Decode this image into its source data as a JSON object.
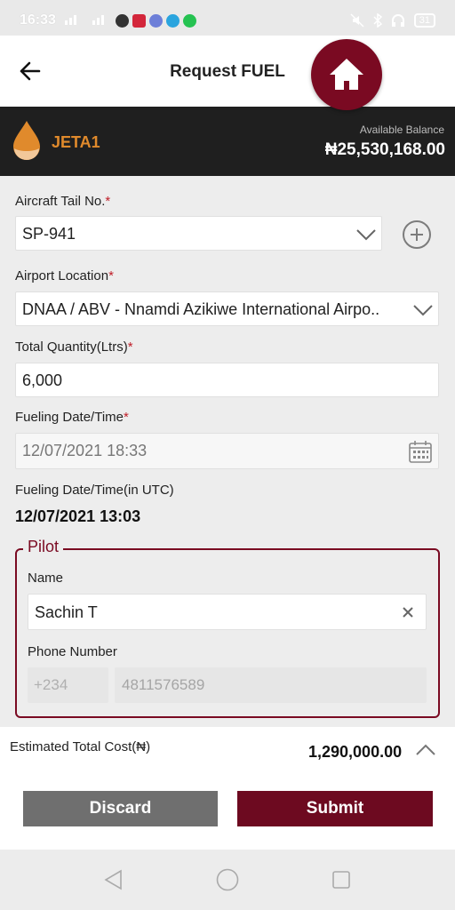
{
  "status_bar": {
    "time": "16:33",
    "battery": "31"
  },
  "header": {
    "title": "Request FUEL"
  },
  "balance": {
    "fuel_name": "JETA1",
    "available_label": "Available Balance",
    "amount": "₦25,530,168.00"
  },
  "form": {
    "aircraft_label": "Aircraft Tail No.",
    "aircraft_value": "SP-941",
    "airport_label": "Airport Location",
    "airport_value": "DNAA / ABV - Nnamdi Azikiwe International Airpo..",
    "quantity_label": "Total Quantity(Ltrs)",
    "quantity_value": "6,000",
    "fuel_date_label": "Fueling Date/Time",
    "fuel_date_value": "12/07/2021 18:33",
    "utc_label": "Fueling Date/Time(in UTC)",
    "utc_value": "12/07/2021 13:03",
    "required_mark": "*"
  },
  "pilot": {
    "legend": "Pilot",
    "name_label": "Name",
    "name_value": "Sachin T",
    "phone_label": "Phone Number",
    "country_code": "+234",
    "phone_value": "4811576589"
  },
  "footer": {
    "estimate_label": "Estimated Total Cost(₦)",
    "estimate_value": "1,290,000.00",
    "discard_label": "Discard",
    "submit_label": "Submit"
  },
  "colors": {
    "brand": "#6d0a20",
    "accent_orange": "#e08a2c",
    "balance_bg": "#1f1f1f"
  }
}
